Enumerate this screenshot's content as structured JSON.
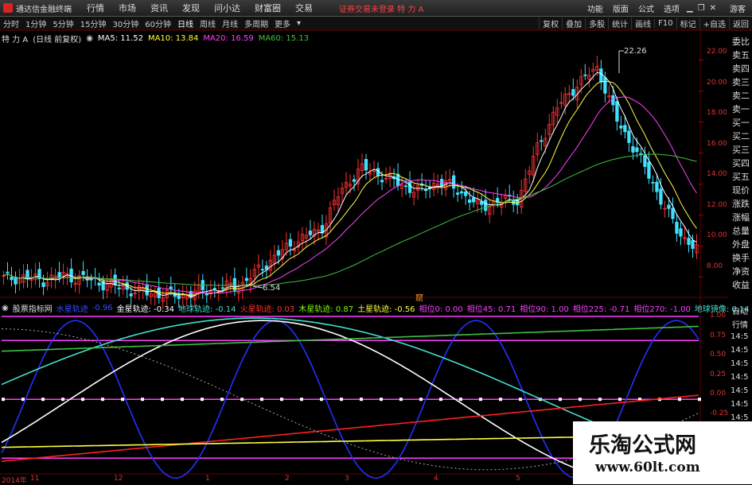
{
  "menubar": {
    "app_title": "通达信金融终端",
    "items": [
      "行情",
      "市场",
      "资讯",
      "发现",
      "问小达",
      "财富圈",
      "交易"
    ],
    "notice": "证券交易未登录  特 力 A",
    "right_items": [
      "功能",
      "版面",
      "公式",
      "选项"
    ],
    "guest": "游客"
  },
  "toolbar": {
    "items": [
      "分时",
      "1分钟",
      "5分钟",
      "15分钟",
      "30分钟",
      "60分钟",
      "日线",
      "周线",
      "月线",
      "多周期",
      "更多"
    ],
    "active": "日线",
    "right_items": [
      "复权",
      "叠加",
      "多股",
      "统计",
      "画线",
      "F10",
      "标记",
      "+自选",
      "返回"
    ]
  },
  "legend_main": {
    "stock": "特 力 A",
    "mode": "(日线 前复权)",
    "ma5": "MA5: 11.52",
    "ma10": "MA10: 13.84",
    "ma20": "MA20: 16.59",
    "ma60": "MA60: 15.13"
  },
  "legend_sub": {
    "name": "股票指标网",
    "items": [
      {
        "text": "水星轨迹",
        "color": "#3a4bff"
      },
      {
        "text": "-0.96",
        "color": "#3a4bff"
      },
      {
        "text": "金星轨迹: -0.34",
        "color": "#ffffff"
      },
      {
        "text": "地球轨迹: -0.14",
        "color": "#40e0d0"
      },
      {
        "text": "火星轨迹: 0.03",
        "color": "#ff3030"
      },
      {
        "text": "木星轨迹: 0.87",
        "color": "#7cfc00"
      },
      {
        "text": "土星轨迹: -0.56",
        "color": "#ffff40"
      },
      {
        "text": "相位0: 0.00",
        "color": "#ff40ff"
      },
      {
        "text": "相位45: 0.71",
        "color": "#ff40ff"
      },
      {
        "text": "相位90: 1.00",
        "color": "#ff40ff"
      },
      {
        "text": "相位225: -0.71",
        "color": "#ff40ff"
      },
      {
        "text": "相位270: -1.00",
        "color": "#ff40ff"
      },
      {
        "text": "地球镜像: 0.14",
        "color": "#40e0d0"
      }
    ]
  },
  "price_axis": [
    "22.00",
    "20.00",
    "18.00",
    "16.00",
    "14.00",
    "12.00",
    "10.00",
    "8.00"
  ],
  "sub_axis": [
    "1.00",
    "0.75",
    "0.50",
    "0.25",
    "0.00",
    "-0.25",
    "-0.50"
  ],
  "high_label": "22.26",
  "low_label": "6.54",
  "marker_text": "窟",
  "x_labels": [
    {
      "text": "2014年",
      "x": 2
    },
    {
      "text": "11",
      "x": 38
    },
    {
      "text": "12",
      "x": 143
    },
    {
      "text": "1",
      "x": 258
    },
    {
      "text": "2",
      "x": 358
    },
    {
      "text": "3",
      "x": 433
    },
    {
      "text": "4",
      "x": 545
    },
    {
      "text": "5",
      "x": 648
    }
  ],
  "right_panel": [
    "委比",
    "卖五",
    "卖四",
    "卖三",
    "卖二",
    "卖一",
    "买一",
    "买二",
    "买三",
    "买四",
    "买五",
    "现价",
    "涨跌",
    "涨幅",
    "总量",
    "外盘",
    "换手",
    "净资",
    "收益"
  ],
  "right_panel_bottom": [
    "自动",
    "行情"
  ],
  "time_list": [
    "14:5",
    "14:5",
    "14:5",
    "14:5",
    "14:5",
    "14:5",
    "14:5",
    "14:5",
    "14:5",
    "14:5"
  ],
  "watermark": {
    "title": "乐淘公式网",
    "url": "www.60lt.com"
  },
  "chart_data": {
    "type": "line",
    "series": [
      {
        "name": "MA5",
        "color": "#ffffff"
      },
      {
        "name": "MA10",
        "color": "#ffff40"
      },
      {
        "name": "MA20",
        "color": "#ff40ff"
      },
      {
        "name": "MA60",
        "color": "#40c040"
      }
    ],
    "price_range": [
      7,
      23
    ],
    "close_approx": [
      7.9,
      8.0,
      7.8,
      8.1,
      7.9,
      7.6,
      7.3,
      7.0,
      6.9,
      6.8,
      7.1,
      7.3,
      7.5,
      8.6,
      9.6,
      10.5,
      11.0,
      13.5,
      15.0,
      14.6,
      14.0,
      13.5,
      14.2,
      13.6,
      12.5,
      12.9,
      13.0,
      16.5,
      19.0,
      20.5,
      21.5,
      18.0,
      16.0,
      13.5,
      11.0,
      9.8
    ]
  }
}
